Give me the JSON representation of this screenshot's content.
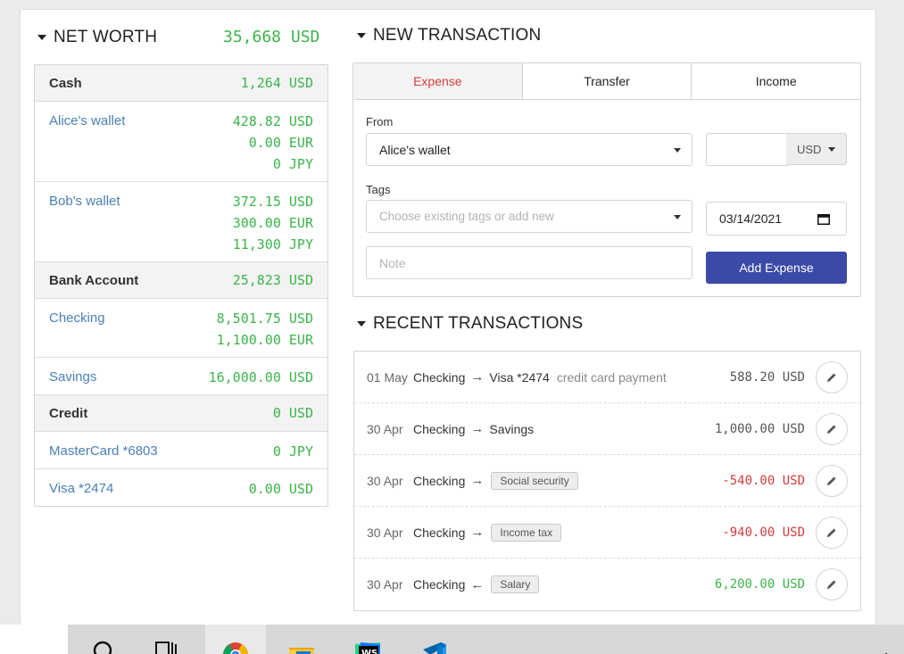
{
  "net_worth": {
    "title": "NET WORTH",
    "total": "35,668 USD",
    "groups": [
      {
        "name": "Cash",
        "total": "1,264 USD",
        "accounts": [
          {
            "name": "Alice's wallet",
            "amounts": [
              "428.82 USD",
              "0.00 EUR",
              "0 JPY"
            ]
          },
          {
            "name": "Bob's wallet",
            "amounts": [
              "372.15 USD",
              "300.00 EUR",
              "11,300 JPY"
            ]
          }
        ]
      },
      {
        "name": "Bank Account",
        "total": "25,823 USD",
        "accounts": [
          {
            "name": "Checking",
            "amounts": [
              "8,501.75 USD",
              "1,100.00 EUR"
            ]
          },
          {
            "name": "Savings",
            "amounts": [
              "16,000.00 USD"
            ]
          }
        ]
      },
      {
        "name": "Credit",
        "total": "0 USD",
        "accounts": [
          {
            "name": "MasterCard *6803",
            "amounts": [
              "0 JPY"
            ]
          },
          {
            "name": "Visa *2474",
            "amounts": [
              "0.00 USD"
            ]
          }
        ]
      }
    ]
  },
  "new_transaction": {
    "title": "NEW TRANSACTION",
    "tabs": [
      "Expense",
      "Transfer",
      "Income"
    ],
    "active_tab": "Expense",
    "from_label": "From",
    "from_value": "Alice's wallet",
    "amount_value": "",
    "currency": "USD",
    "tags_label": "Tags",
    "tags_placeholder": "Choose existing tags or add new",
    "date_value": "03/14/2021",
    "note_placeholder": "Note",
    "submit_label": "Add Expense"
  },
  "recent": {
    "title": "RECENT TRANSACTIONS",
    "transactions": [
      {
        "date": "01 May",
        "from": "Checking",
        "direction": "→",
        "to": "Visa *2474",
        "tag": "",
        "note": "credit card payment",
        "amount": "588.20 USD",
        "color": "#555555"
      },
      {
        "date": "30 Apr",
        "from": "Checking",
        "direction": "→",
        "to": "Savings",
        "tag": "",
        "note": "",
        "amount": "1,000.00 USD",
        "color": "#555555"
      },
      {
        "date": "30 Apr",
        "from": "Checking",
        "direction": "→",
        "to": "",
        "tag": "Social security",
        "note": "",
        "amount": "-540.00 USD",
        "color": "#d43b3b"
      },
      {
        "date": "30 Apr",
        "from": "Checking",
        "direction": "→",
        "to": "",
        "tag": "Income tax",
        "note": "",
        "amount": "-940.00 USD",
        "color": "#d43b3b"
      },
      {
        "date": "30 Apr",
        "from": "Checking",
        "direction": "←",
        "to": "",
        "tag": "Salary",
        "note": "",
        "amount": "6,200.00 USD",
        "color": "#3cb44a"
      }
    ]
  },
  "taskbar": {
    "icons": [
      "search-icon",
      "task-view-icon",
      "chrome-icon",
      "file-explorer-icon",
      "webstorm-icon",
      "vscode-icon",
      "show-hidden-icons-chevron"
    ]
  }
}
